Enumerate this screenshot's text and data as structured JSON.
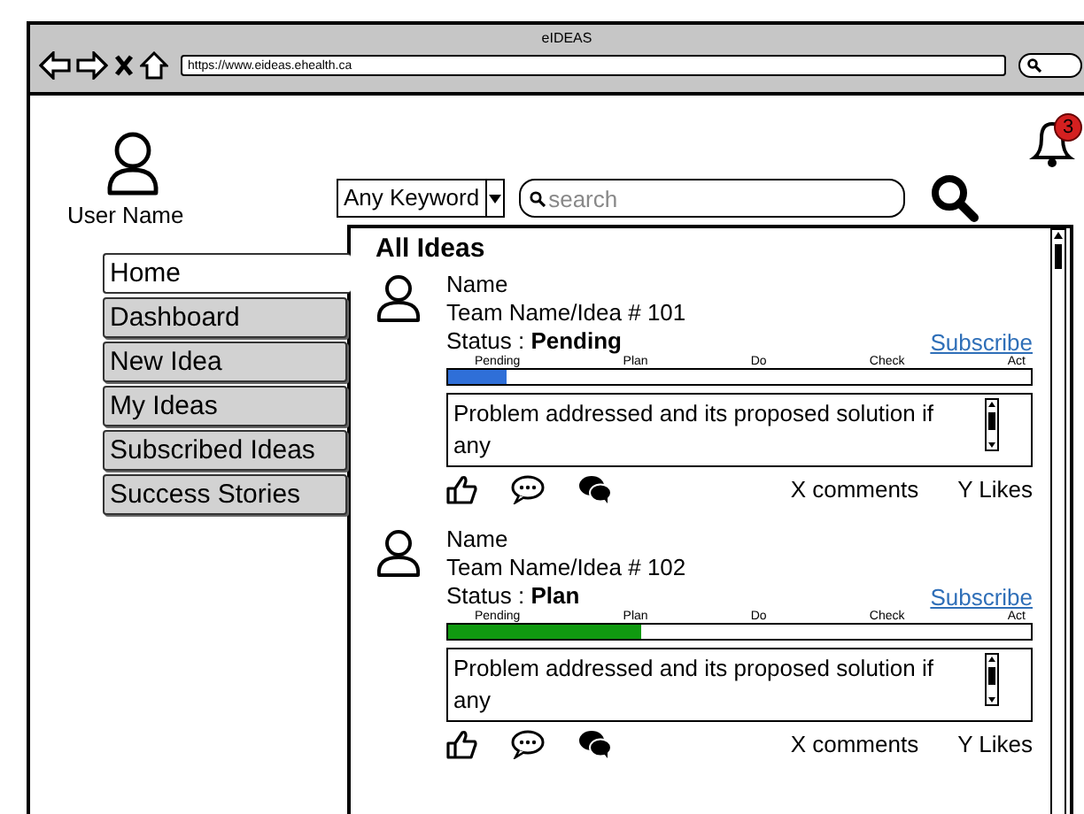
{
  "window": {
    "title": "eIDEAS",
    "url": "https://www.eideas.ehealth.ca"
  },
  "user": {
    "name": "User Name"
  },
  "notifications": {
    "badge": "3"
  },
  "search": {
    "filter": "Any Keyword",
    "placeholder": "search"
  },
  "nav": [
    {
      "label": "Home",
      "selected": true
    },
    {
      "label": "Dashboard",
      "selected": false
    },
    {
      "label": "New Idea",
      "selected": false
    },
    {
      "label": "My Ideas",
      "selected": false
    },
    {
      "label": "Subscribed Ideas",
      "selected": false
    },
    {
      "label": "Success Stories",
      "selected": false
    }
  ],
  "panel": {
    "title": "All Ideas"
  },
  "ideas": [
    {
      "name": "Name",
      "team": "Team Name/Idea # 101",
      "status_label": "Status :",
      "status": "Pending",
      "subscribe": "Subscribe",
      "stages": [
        "Pending",
        "Plan",
        "Do",
        "Check",
        "Act"
      ],
      "level": 0.1,
      "color": "#2f6fd8",
      "description": "Problem addressed and its proposed solution if any",
      "comments": "X comments",
      "likes": "Y Likes"
    },
    {
      "name": "Name",
      "team": "Team Name/Idea # 102",
      "status_label": "Status :",
      "status": "Plan",
      "subscribe": "Subscribe",
      "stages": [
        "Pending",
        "Plan",
        "Do",
        "Check",
        "Act"
      ],
      "level": 0.33,
      "color": "#109a10",
      "description": "Problem addressed and its proposed solution if any",
      "comments": "X comments",
      "likes": "Y Likes"
    }
  ]
}
